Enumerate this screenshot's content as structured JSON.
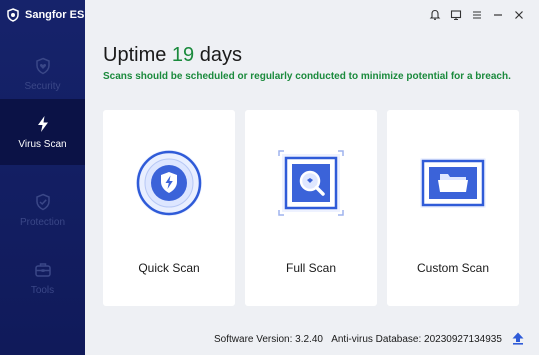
{
  "app": {
    "name": "Sangfor ES"
  },
  "sidebar": {
    "items": [
      {
        "label": "Security",
        "icon": "shield-heart-icon",
        "active": false
      },
      {
        "label": "Virus Scan",
        "icon": "lightning-icon",
        "active": true
      },
      {
        "label": "Protection",
        "icon": "shield-check-icon",
        "active": false
      },
      {
        "label": "Tools",
        "icon": "toolbox-icon",
        "active": false
      }
    ]
  },
  "titlebar": {
    "icons": [
      "bell-icon",
      "monitor-icon",
      "menu-icon",
      "minimize-icon",
      "close-icon"
    ]
  },
  "header": {
    "uptime_prefix": "Uptime",
    "uptime_days": "19",
    "uptime_suffix": "days",
    "hint": "Scans should be scheduled or regularly conducted to minimize potential for a breach."
  },
  "scan_cards": [
    {
      "label": "Quick Scan",
      "icon": "quick-scan-icon"
    },
    {
      "label": "Full Scan",
      "icon": "full-scan-icon"
    },
    {
      "label": "Custom Scan",
      "icon": "custom-scan-icon"
    }
  ],
  "footer": {
    "software_version": "Software Version: 3.2.40",
    "antivirus_database": "Anti-virus Database: 20230927134935"
  },
  "colors": {
    "sidebar_bg": "#16236b",
    "sidebar_active": "#0b1246",
    "accent_green": "#1a8a3c",
    "accent_blue": "#2f5bd8"
  }
}
